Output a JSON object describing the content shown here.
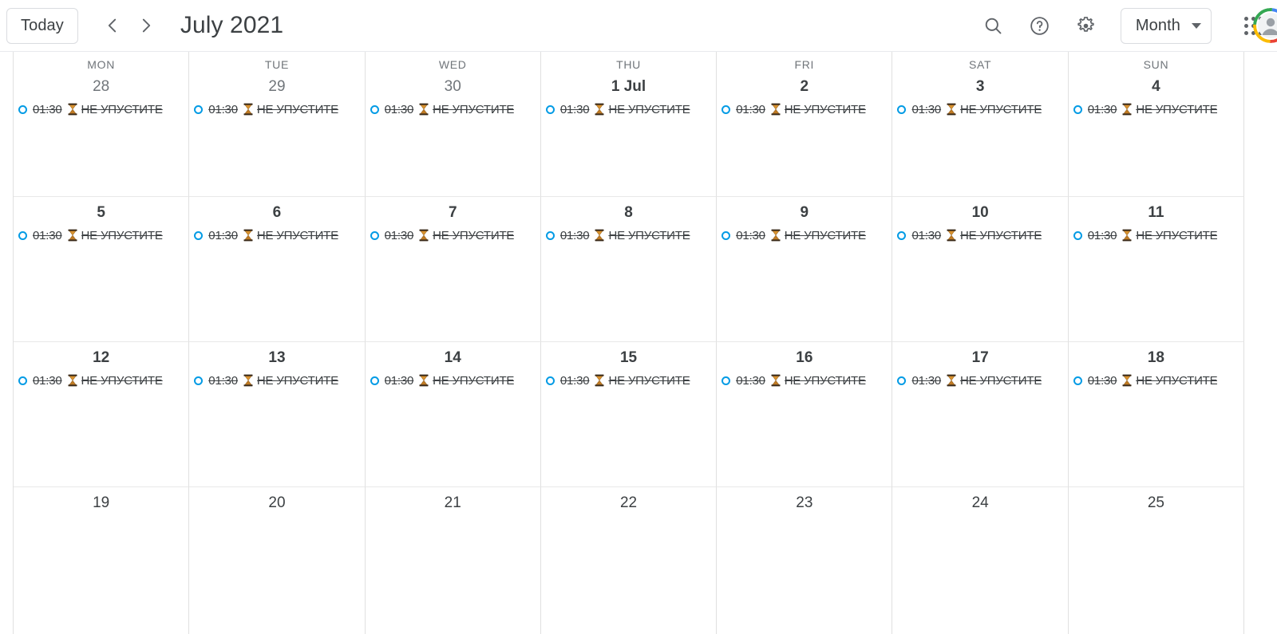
{
  "header": {
    "today_label": "Today",
    "prev_label": "Previous period",
    "next_label": "Next period",
    "title": "July 2021",
    "search_icon": "search-icon",
    "help_icon": "help-circle-icon",
    "settings_icon": "gear-icon",
    "view_label": "Month",
    "apps_icon": "apps-grid-icon",
    "avatar_icon": "user-avatar"
  },
  "calendar": {
    "weekday_headers": [
      "MON",
      "TUE",
      "WED",
      "THU",
      "FRI",
      "SAT",
      "SUN"
    ],
    "event": {
      "time": "01:30",
      "emoji": "hourglass-emoji",
      "title": "НЕ УПУСТИТЕ",
      "dot_color": "#039be5",
      "completed": true
    },
    "weeks": [
      {
        "days": [
          {
            "label": "28",
            "style": "muted",
            "events": 1
          },
          {
            "label": "29",
            "style": "muted",
            "events": 1
          },
          {
            "label": "30",
            "style": "muted",
            "events": 1
          },
          {
            "label": "1 Jul",
            "style": "current",
            "events": 1
          },
          {
            "label": "2",
            "style": "current",
            "events": 1
          },
          {
            "label": "3",
            "style": "current",
            "events": 1
          },
          {
            "label": "4",
            "style": "current",
            "events": 1
          }
        ]
      },
      {
        "days": [
          {
            "label": "5",
            "style": "current",
            "events": 1
          },
          {
            "label": "6",
            "style": "current",
            "events": 1
          },
          {
            "label": "7",
            "style": "current",
            "events": 1
          },
          {
            "label": "8",
            "style": "current",
            "events": 1
          },
          {
            "label": "9",
            "style": "current",
            "events": 1
          },
          {
            "label": "10",
            "style": "current",
            "events": 1
          },
          {
            "label": "11",
            "style": "current",
            "events": 1
          }
        ]
      },
      {
        "days": [
          {
            "label": "12",
            "style": "current",
            "events": 1
          },
          {
            "label": "13",
            "style": "current",
            "events": 1
          },
          {
            "label": "14",
            "style": "current",
            "events": 1
          },
          {
            "label": "15",
            "style": "current",
            "events": 1
          },
          {
            "label": "16",
            "style": "current",
            "events": 1
          },
          {
            "label": "17",
            "style": "current",
            "events": 1
          },
          {
            "label": "18",
            "style": "current",
            "events": 1
          }
        ]
      },
      {
        "days": [
          {
            "label": "19",
            "style": "plain",
            "events": 0
          },
          {
            "label": "20",
            "style": "plain",
            "events": 0
          },
          {
            "label": "21",
            "style": "plain",
            "events": 0
          },
          {
            "label": "22",
            "style": "plain",
            "events": 0
          },
          {
            "label": "23",
            "style": "plain",
            "events": 0
          },
          {
            "label": "24",
            "style": "plain",
            "events": 0
          },
          {
            "label": "25",
            "style": "plain",
            "events": 0
          }
        ]
      }
    ]
  }
}
